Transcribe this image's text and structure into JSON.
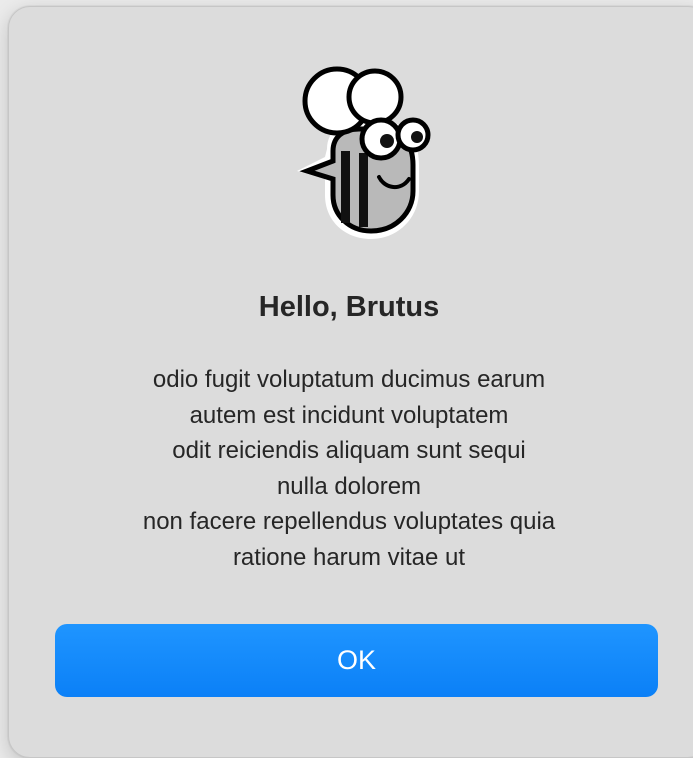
{
  "alert": {
    "icon": "bee-app-icon",
    "title": "Hello, Brutus",
    "message_lines": [
      "odio fugit voluptatum ducimus earum",
      "autem est incidunt voluptatem",
      "odit reiciendis aliquam sunt sequi",
      "nulla dolorem",
      "non facere repellendus voluptates quia",
      "ratione harum vitae ut"
    ],
    "ok_label": "OK"
  },
  "colors": {
    "dialog_background": "#dcdcdc",
    "button_accent": "#0b80f7",
    "text": "#262626"
  }
}
